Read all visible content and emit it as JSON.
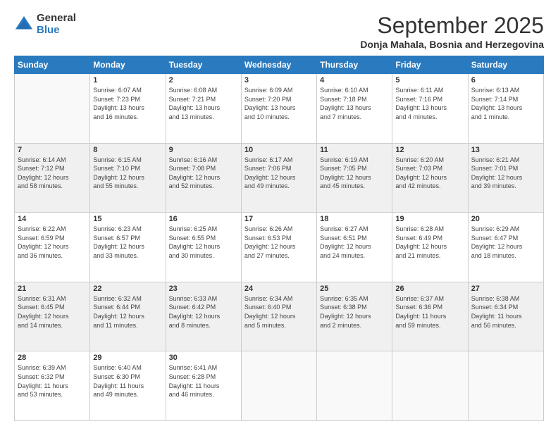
{
  "logo": {
    "general": "General",
    "blue": "Blue"
  },
  "header": {
    "month": "September 2025",
    "location": "Donja Mahala, Bosnia and Herzegovina"
  },
  "days_of_week": [
    "Sunday",
    "Monday",
    "Tuesday",
    "Wednesday",
    "Thursday",
    "Friday",
    "Saturday"
  ],
  "weeks": [
    [
      {
        "num": "",
        "info": ""
      },
      {
        "num": "1",
        "info": "Sunrise: 6:07 AM\nSunset: 7:23 PM\nDaylight: 13 hours\nand 16 minutes."
      },
      {
        "num": "2",
        "info": "Sunrise: 6:08 AM\nSunset: 7:21 PM\nDaylight: 13 hours\nand 13 minutes."
      },
      {
        "num": "3",
        "info": "Sunrise: 6:09 AM\nSunset: 7:20 PM\nDaylight: 13 hours\nand 10 minutes."
      },
      {
        "num": "4",
        "info": "Sunrise: 6:10 AM\nSunset: 7:18 PM\nDaylight: 13 hours\nand 7 minutes."
      },
      {
        "num": "5",
        "info": "Sunrise: 6:11 AM\nSunset: 7:16 PM\nDaylight: 13 hours\nand 4 minutes."
      },
      {
        "num": "6",
        "info": "Sunrise: 6:13 AM\nSunset: 7:14 PM\nDaylight: 13 hours\nand 1 minute."
      }
    ],
    [
      {
        "num": "7",
        "info": "Sunrise: 6:14 AM\nSunset: 7:12 PM\nDaylight: 12 hours\nand 58 minutes."
      },
      {
        "num": "8",
        "info": "Sunrise: 6:15 AM\nSunset: 7:10 PM\nDaylight: 12 hours\nand 55 minutes."
      },
      {
        "num": "9",
        "info": "Sunrise: 6:16 AM\nSunset: 7:08 PM\nDaylight: 12 hours\nand 52 minutes."
      },
      {
        "num": "10",
        "info": "Sunrise: 6:17 AM\nSunset: 7:06 PM\nDaylight: 12 hours\nand 49 minutes."
      },
      {
        "num": "11",
        "info": "Sunrise: 6:19 AM\nSunset: 7:05 PM\nDaylight: 12 hours\nand 45 minutes."
      },
      {
        "num": "12",
        "info": "Sunrise: 6:20 AM\nSunset: 7:03 PM\nDaylight: 12 hours\nand 42 minutes."
      },
      {
        "num": "13",
        "info": "Sunrise: 6:21 AM\nSunset: 7:01 PM\nDaylight: 12 hours\nand 39 minutes."
      }
    ],
    [
      {
        "num": "14",
        "info": "Sunrise: 6:22 AM\nSunset: 6:59 PM\nDaylight: 12 hours\nand 36 minutes."
      },
      {
        "num": "15",
        "info": "Sunrise: 6:23 AM\nSunset: 6:57 PM\nDaylight: 12 hours\nand 33 minutes."
      },
      {
        "num": "16",
        "info": "Sunrise: 6:25 AM\nSunset: 6:55 PM\nDaylight: 12 hours\nand 30 minutes."
      },
      {
        "num": "17",
        "info": "Sunrise: 6:26 AM\nSunset: 6:53 PM\nDaylight: 12 hours\nand 27 minutes."
      },
      {
        "num": "18",
        "info": "Sunrise: 6:27 AM\nSunset: 6:51 PM\nDaylight: 12 hours\nand 24 minutes."
      },
      {
        "num": "19",
        "info": "Sunrise: 6:28 AM\nSunset: 6:49 PM\nDaylight: 12 hours\nand 21 minutes."
      },
      {
        "num": "20",
        "info": "Sunrise: 6:29 AM\nSunset: 6:47 PM\nDaylight: 12 hours\nand 18 minutes."
      }
    ],
    [
      {
        "num": "21",
        "info": "Sunrise: 6:31 AM\nSunset: 6:45 PM\nDaylight: 12 hours\nand 14 minutes."
      },
      {
        "num": "22",
        "info": "Sunrise: 6:32 AM\nSunset: 6:44 PM\nDaylight: 12 hours\nand 11 minutes."
      },
      {
        "num": "23",
        "info": "Sunrise: 6:33 AM\nSunset: 6:42 PM\nDaylight: 12 hours\nand 8 minutes."
      },
      {
        "num": "24",
        "info": "Sunrise: 6:34 AM\nSunset: 6:40 PM\nDaylight: 12 hours\nand 5 minutes."
      },
      {
        "num": "25",
        "info": "Sunrise: 6:35 AM\nSunset: 6:38 PM\nDaylight: 12 hours\nand 2 minutes."
      },
      {
        "num": "26",
        "info": "Sunrise: 6:37 AM\nSunset: 6:36 PM\nDaylight: 11 hours\nand 59 minutes."
      },
      {
        "num": "27",
        "info": "Sunrise: 6:38 AM\nSunset: 6:34 PM\nDaylight: 11 hours\nand 56 minutes."
      }
    ],
    [
      {
        "num": "28",
        "info": "Sunrise: 6:39 AM\nSunset: 6:32 PM\nDaylight: 11 hours\nand 53 minutes."
      },
      {
        "num": "29",
        "info": "Sunrise: 6:40 AM\nSunset: 6:30 PM\nDaylight: 11 hours\nand 49 minutes."
      },
      {
        "num": "30",
        "info": "Sunrise: 6:41 AM\nSunset: 6:28 PM\nDaylight: 11 hours\nand 46 minutes."
      },
      {
        "num": "",
        "info": ""
      },
      {
        "num": "",
        "info": ""
      },
      {
        "num": "",
        "info": ""
      },
      {
        "num": "",
        "info": ""
      }
    ]
  ]
}
